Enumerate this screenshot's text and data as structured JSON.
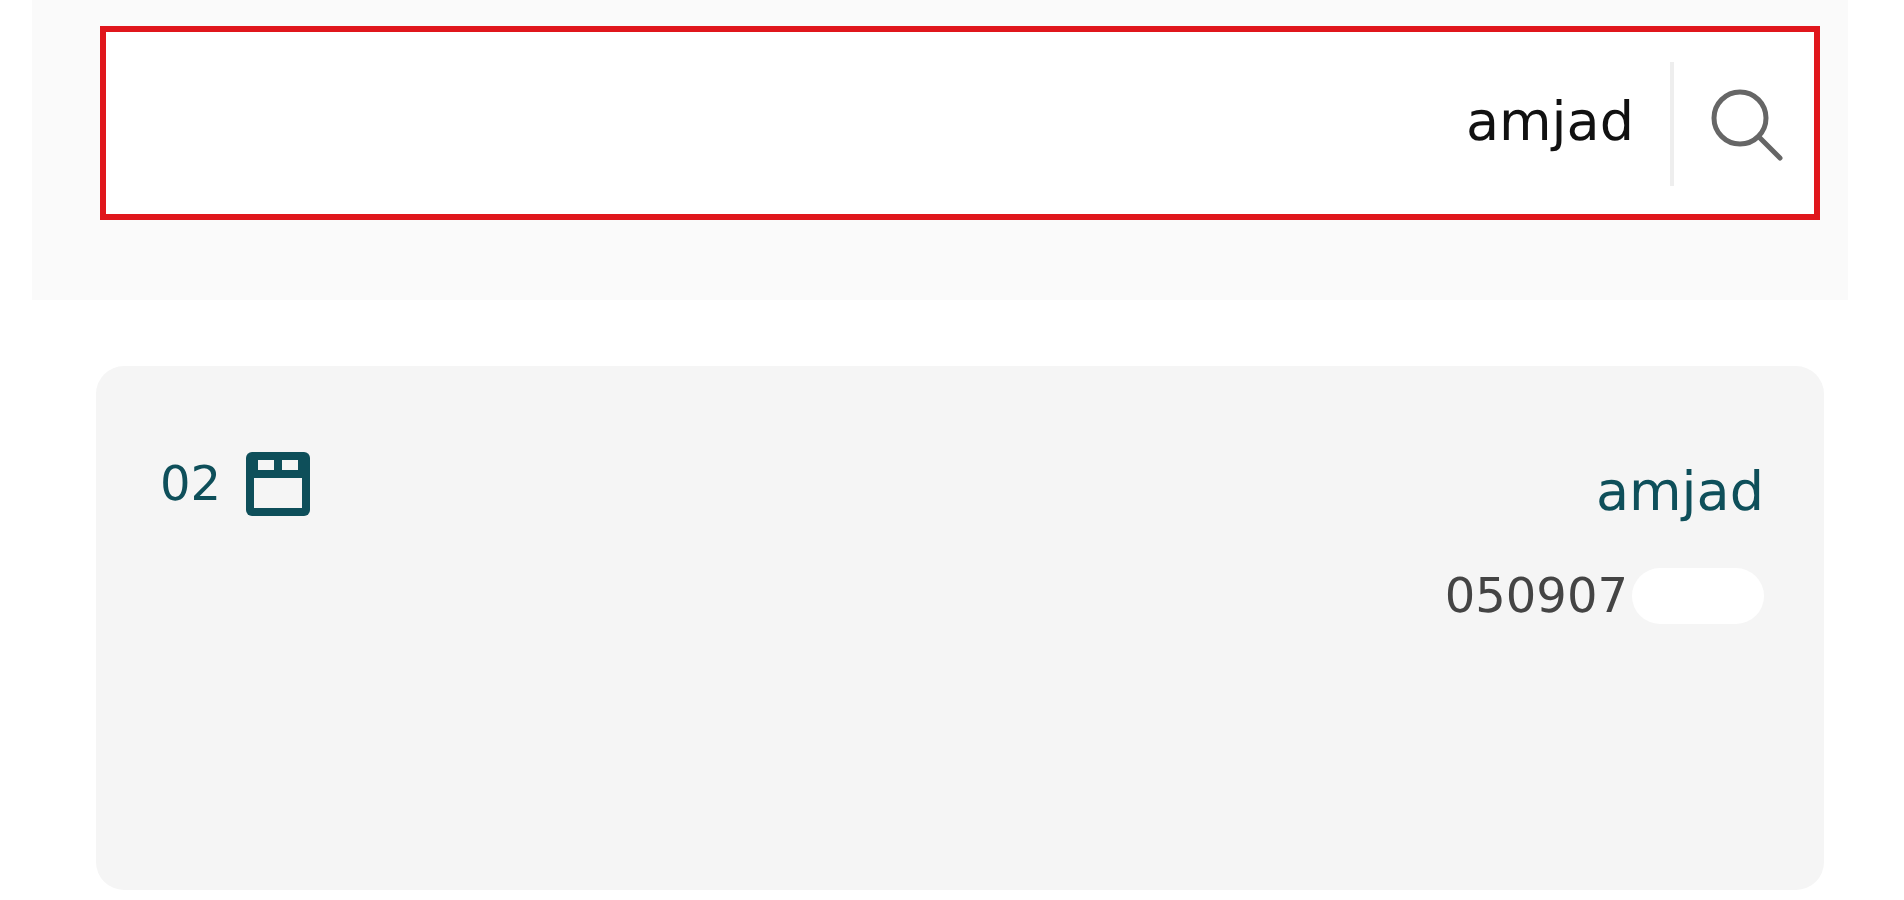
{
  "search": {
    "value": "amjad",
    "highlighted": true
  },
  "results": [
    {
      "count": "02",
      "name": "amjad",
      "phone": "050907",
      "phone_redacted": true
    }
  ]
}
